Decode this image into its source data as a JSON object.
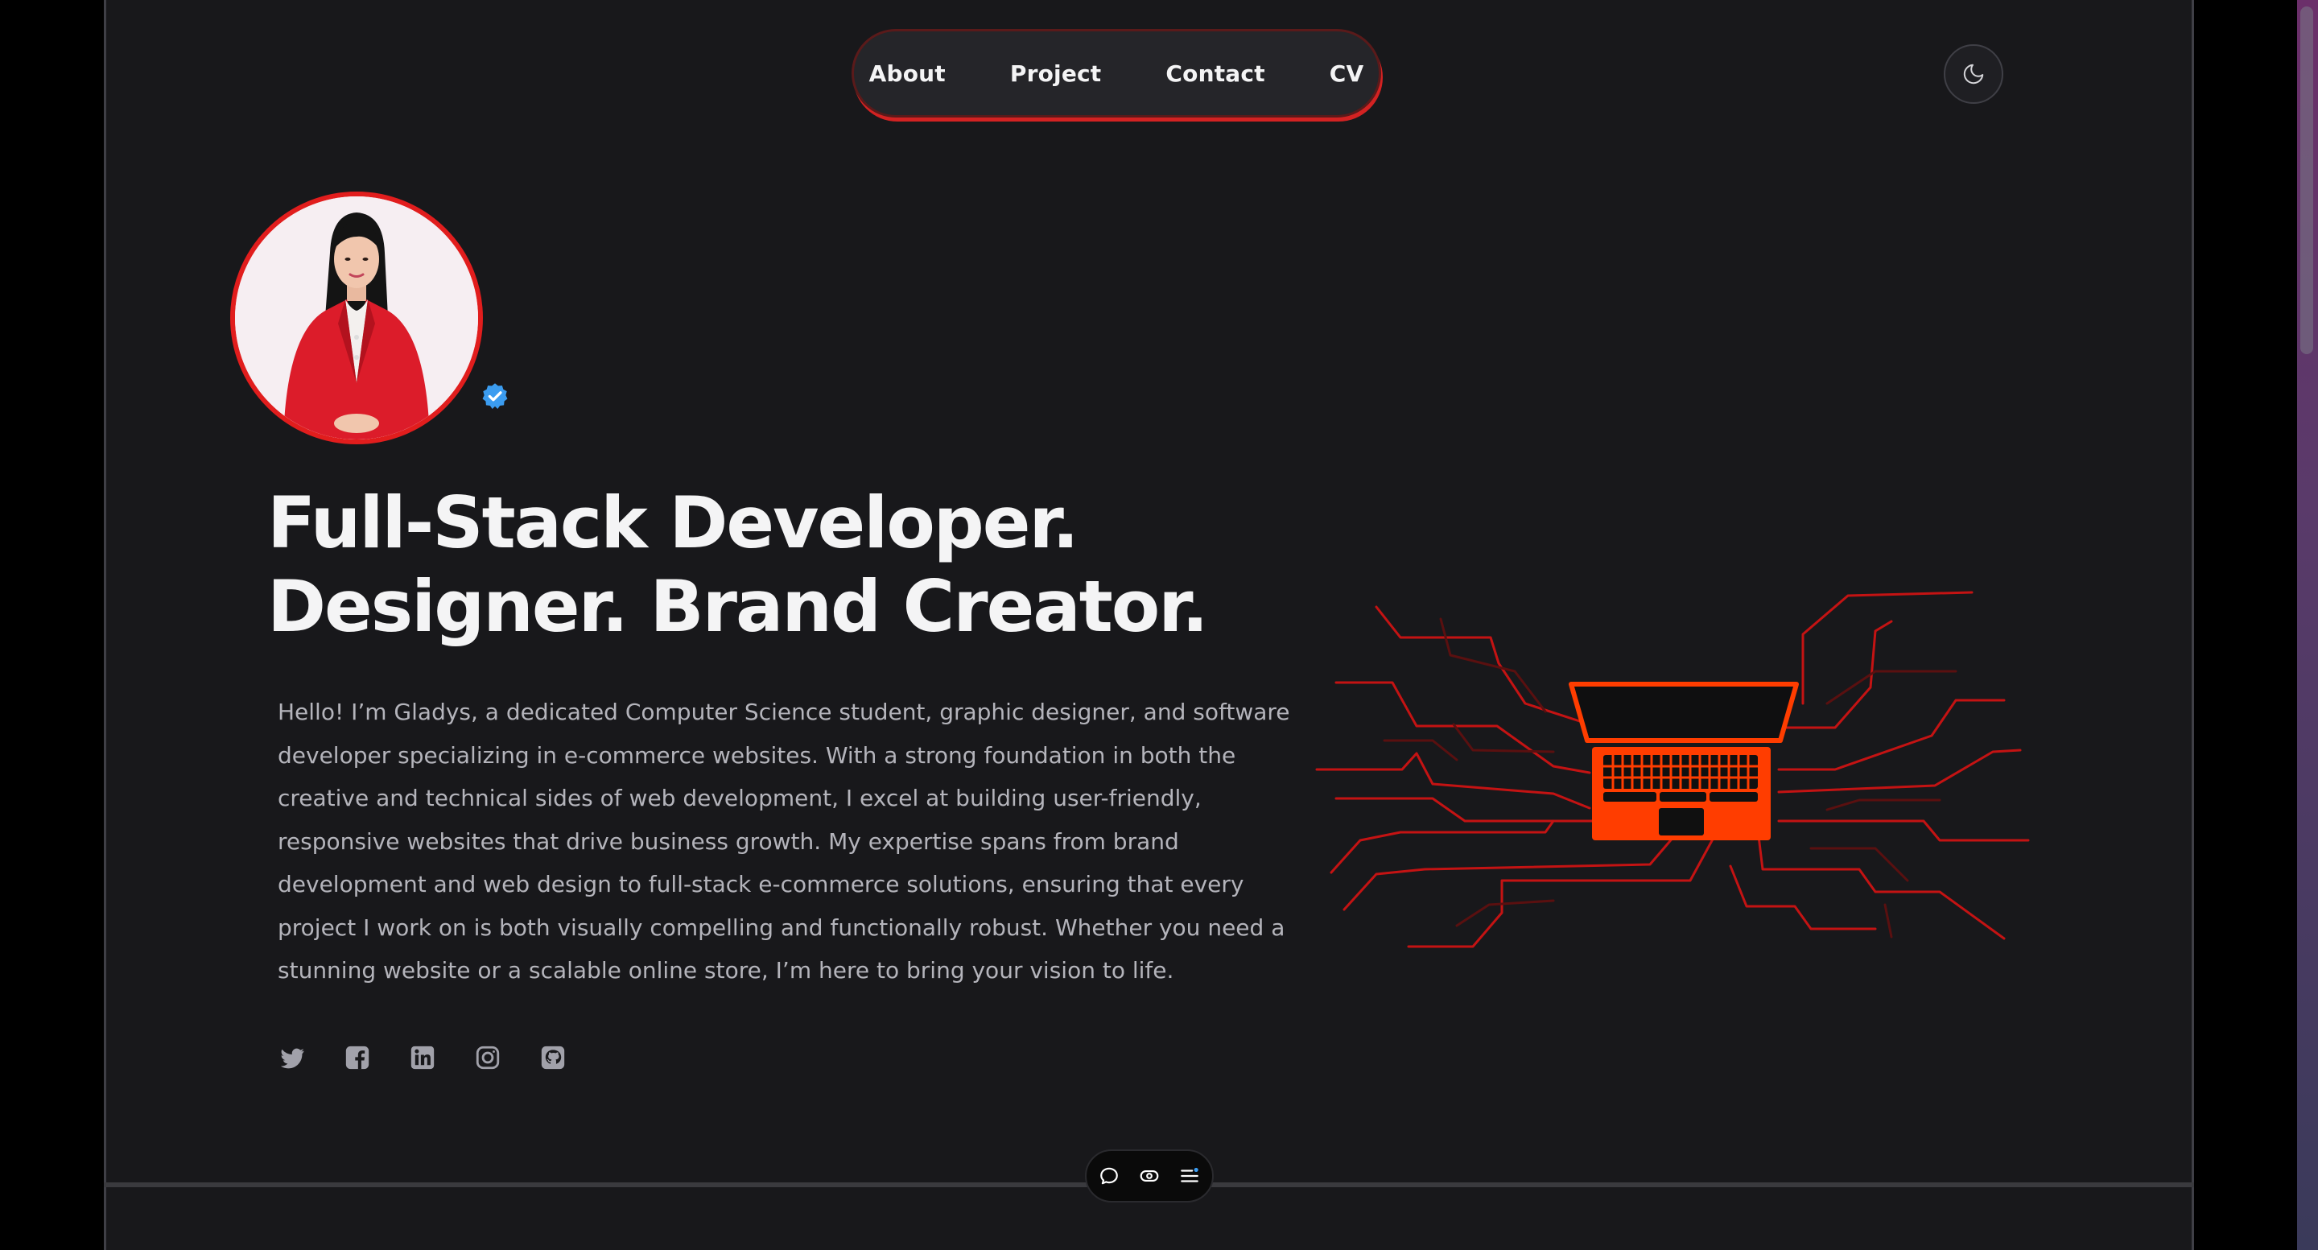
{
  "nav": {
    "items": [
      {
        "label": "About"
      },
      {
        "label": "Project"
      },
      {
        "label": "Contact"
      },
      {
        "label": "CV"
      }
    ]
  },
  "theme_toggle": {
    "icon": "moon-icon"
  },
  "profile": {
    "avatar_icon": "profile-photo",
    "verified_icon": "verified-badge-icon"
  },
  "hero": {
    "headline_line1": "Full-Stack Developer.",
    "headline_line2": "Designer. Brand Creator.",
    "bio": "Hello! I’m Gladys, a dedicated Computer Science student, graphic designer, and software developer specializing in e-commerce websites. With a strong foundation in both the creative and technical sides of web development, I excel at building user-friendly, responsive websites that drive business growth. My expertise spans from brand development and web design to full-stack e-commerce solutions, ensuring that every project I work on is both visually compelling and functionally robust. Whether you need a stunning website or a scalable online store, I’m here to bring your vision to life."
  },
  "socials": [
    {
      "icon": "twitter-icon"
    },
    {
      "icon": "facebook-icon"
    },
    {
      "icon": "linkedin-icon"
    },
    {
      "icon": "instagram-icon"
    },
    {
      "icon": "github-icon"
    }
  ],
  "floating_toolbar": {
    "items": [
      {
        "icon": "chat-bubble-icon"
      },
      {
        "icon": "eye-icon"
      },
      {
        "icon": "menu-list-icon"
      }
    ]
  },
  "colors": {
    "background": "#18181b",
    "accent": "#e11d1d",
    "illustration_orange": "#ff3d00",
    "text_primary": "#f4f4f5",
    "text_secondary": "#b4b4bb",
    "verified_blue": "#3b9cf0"
  }
}
